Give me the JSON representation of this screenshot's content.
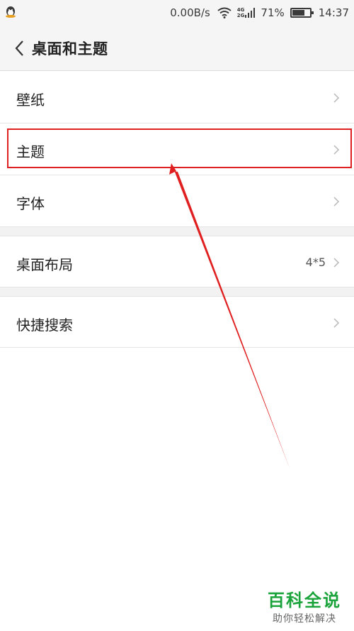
{
  "status_bar": {
    "net_speed": "0.00B/s",
    "net_type_top": "4G",
    "net_type_bottom": "2G",
    "battery": "71%",
    "battery_level": 0.71,
    "time": "14:37",
    "icons": [
      "qq-icon",
      "wifi-icon",
      "signal-icon",
      "battery-icon"
    ]
  },
  "header": {
    "back_icon": "chevron-left-icon",
    "title": "桌面和主题"
  },
  "list": {
    "wallpaper": "壁纸",
    "theme": "主题",
    "font": "字体",
    "desktop_layout": "桌面布局",
    "desktop_layout_value": "4*5",
    "quick_search": "快捷搜索",
    "chevron_icon": "chevron-right-icon"
  },
  "annotation": {
    "color": "#e02020"
  },
  "watermark": {
    "brand": "百科全说",
    "tagline": "助你轻松解决",
    "color": "#1aa33a"
  }
}
